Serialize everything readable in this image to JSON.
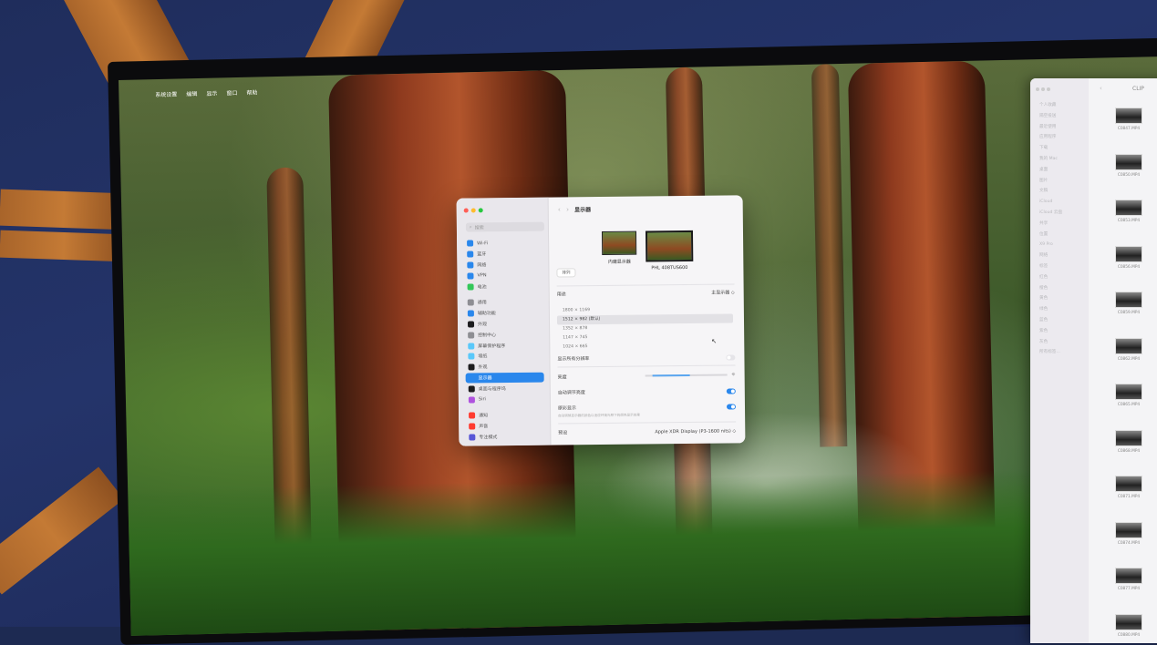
{
  "menubar": {
    "items": [
      "系统设置",
      "编辑",
      "显示",
      "窗口",
      "帮助"
    ]
  },
  "settings": {
    "search_placeholder": "搜索",
    "sidebar": {
      "items": [
        {
          "label": "Wi-Fi",
          "icon": "wifi-icon",
          "color": "#2a87ec",
          "active": false
        },
        {
          "label": "蓝牙",
          "icon": "bluetooth-icon",
          "color": "#2a87ec",
          "active": false
        },
        {
          "label": "网络",
          "icon": "globe-icon",
          "color": "#2a87ec",
          "active": false
        },
        {
          "label": "VPN",
          "icon": "vpn-icon",
          "color": "#2a87ec",
          "active": false
        },
        {
          "label": "电池",
          "icon": "battery-icon",
          "color": "#34c759",
          "active": false
        },
        {
          "label": "通用",
          "icon": "gear-icon",
          "color": "#8e8e93",
          "active": false
        },
        {
          "label": "辅助功能",
          "icon": "accessibility-icon",
          "color": "#2a87ec",
          "active": false
        },
        {
          "label": "外观",
          "icon": "appearance-icon",
          "color": "#1c1c1e",
          "active": false
        },
        {
          "label": "控制中心",
          "icon": "control-center-icon",
          "color": "#8e8e93",
          "active": false
        },
        {
          "label": "屏幕保护程序",
          "icon": "screensaver-icon",
          "color": "#5ac8fa",
          "active": false
        },
        {
          "label": "墙纸",
          "icon": "wallpaper-icon",
          "color": "#5ac8fa",
          "active": false
        },
        {
          "label": "外观",
          "icon": "dock-icon",
          "color": "#1c1c1e",
          "active": false
        },
        {
          "label": "显示器",
          "icon": "display-icon",
          "color": "#2a87ec",
          "active": true
        },
        {
          "label": "桌面与程序坞",
          "icon": "desktop-dock-icon",
          "color": "#1c1c1e",
          "active": false
        },
        {
          "label": "Siri",
          "icon": "siri-icon",
          "color": "#af52de",
          "active": false
        },
        {
          "label": "通知",
          "icon": "notifications-icon",
          "color": "#ff3b30",
          "active": false
        },
        {
          "label": "声音",
          "icon": "sound-icon",
          "color": "#ff3b30",
          "active": false
        },
        {
          "label": "专注模式",
          "icon": "focus-icon",
          "color": "#5856d6",
          "active": false
        }
      ]
    },
    "toolbar": {
      "title": "显示器"
    },
    "displays": [
      {
        "label": "内建显示器"
      },
      {
        "label": "PHL 408TUS600"
      }
    ],
    "arrange_label": "排列",
    "usage_label": "用途",
    "usage_value": "主显示器 ◇",
    "resolutions": [
      {
        "label": "1800 × 1169",
        "selected": false
      },
      {
        "label": "1512 × 982 (默认)",
        "selected": true
      },
      {
        "label": "1352 × 878",
        "selected": false
      },
      {
        "label": "1147 × 745",
        "selected": false
      },
      {
        "label": "1024 × 665",
        "selected": false
      }
    ],
    "show_all_label": "显示所有分辨率",
    "brightness_label": "亮度",
    "brightness_level": 0.45,
    "auto_brightness_label": "自动调节亮度",
    "true_tone_label": "原彩显示",
    "true_tone_desc": "自动调整显示器的颜色以适应环境光照下的颜色显示效果",
    "preset_label": "预设",
    "preset_value": "Apple XDR Display (P3-1600 nits) ◇"
  },
  "finder": {
    "title": "CLIP",
    "sidebar": [
      "个人收藏",
      "隔空投送",
      "最近使用",
      "应用程序",
      "下载",
      "我的 Mac",
      "桌面",
      "图片",
      "文稿",
      "iCloud",
      "iCloud 云盘",
      "共享",
      "位置",
      "X9 Pro",
      "网络",
      "标签",
      "红色",
      "橙色",
      "黄色",
      "绿色",
      "蓝色",
      "紫色",
      "灰色",
      "所有标签…"
    ],
    "files": [
      "C0847.MP4",
      "C0850.MP4",
      "C0853.MP4",
      "C0856.MP4",
      "C0859.MP4",
      "C0862.MP4",
      "C0865.MP4",
      "C0868.MP4",
      "C0871.MP4",
      "C0874.MP4",
      "C0877.MP4",
      "C0880.MP4"
    ]
  }
}
